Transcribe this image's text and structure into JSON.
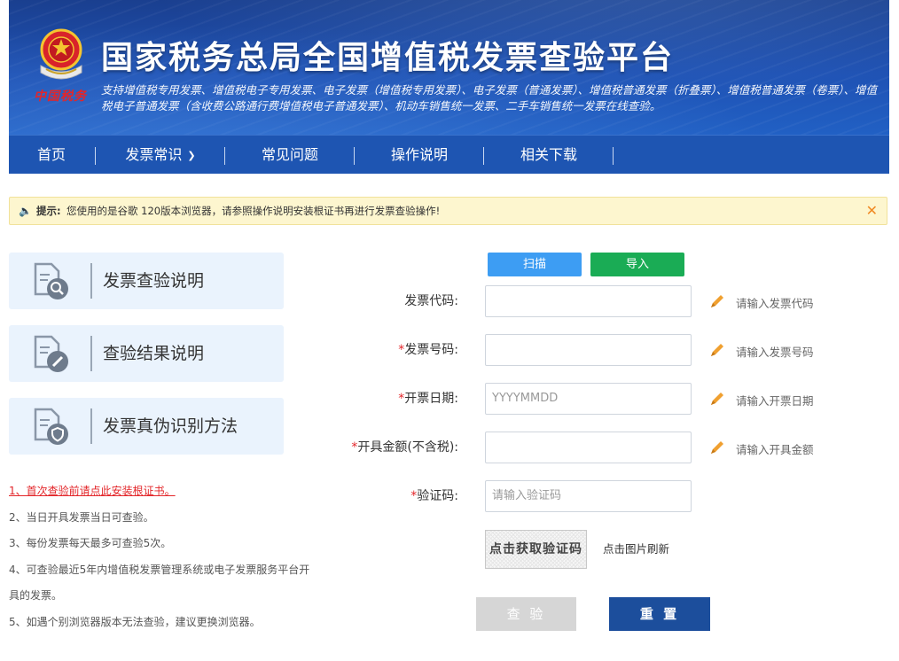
{
  "header": {
    "brand_mark": "中国税务",
    "title": "国家税务总局全国增值税发票查验平台",
    "subtitle": "支持增值税专用发票、增值税电子专用发票、电子发票（增值税专用发票）、电子发票（普通发票）、增值税普通发票（折叠票）、增值税普通发票（卷票）、增值税电子普通发票（含收费公路通行费增值税电子普通发票）、机动车销售统一发票、二手车销售统一发票在线查验。"
  },
  "nav": {
    "items": [
      {
        "label": "首页"
      },
      {
        "label": "发票常识"
      },
      {
        "label": "常见问题"
      },
      {
        "label": "操作说明"
      },
      {
        "label": "相关下载"
      }
    ],
    "dropdown_icon": "chevron-down-icon"
  },
  "notice": {
    "icon": "speaker-icon",
    "label": "提示:",
    "message": "您使用的是谷歌 120版本浏览器，请参照操作说明安装根证书再进行发票查验操作!",
    "close": "✕"
  },
  "sidebar": {
    "cards": [
      {
        "label": "发票查验说明",
        "icon": "magnifier-doc-icon"
      },
      {
        "label": "查验结果说明",
        "icon": "pen-doc-icon"
      },
      {
        "label": "发票真伪识别方法",
        "icon": "shield-doc-icon"
      }
    ],
    "tips": [
      "1、首次查验前请点此安装根证书。",
      "2、当日开具发票当日可查验。",
      "3、每份发票每天最多可查验5次。",
      "4、可查验最近5年内增值税发票管理系统或电子发票服务平台开具的发票。",
      "5、如遇个别浏览器版本无法查验，建议更换浏览器。"
    ]
  },
  "form": {
    "scan_label": "扫描",
    "import_label": "导入",
    "fields": [
      {
        "required": "",
        "label": "发票代码:",
        "value": "",
        "placeholder": "",
        "hint": "请输入发票代码"
      },
      {
        "required": "*",
        "label": "发票号码:",
        "value": "",
        "placeholder": "",
        "hint": "请输入发票号码"
      },
      {
        "required": "*",
        "label": "开票日期:",
        "value": "",
        "placeholder": "YYYYMMDD",
        "hint": "请输入开票日期"
      },
      {
        "required": "*",
        "label": "开具金额(不含税):",
        "value": "",
        "placeholder": "",
        "hint": "请输入开具金额"
      },
      {
        "required": "*",
        "label": "验证码:",
        "value": "",
        "placeholder": "请输入验证码",
        "hint": ""
      }
    ],
    "captcha_text": "点击获取验证码",
    "captcha_refresh": "点击图片刷新",
    "check_label": "查 验",
    "reset_label": "重 置"
  },
  "colors": {
    "header_blue": "#1f52b4",
    "nav_blue": "#1e55b2",
    "scan_blue": "#3d9df3",
    "import_green": "#1aac55",
    "reset_blue": "#1c4e9c",
    "required_red": "#e3262a",
    "notice_bg": "#fdf6cf"
  }
}
